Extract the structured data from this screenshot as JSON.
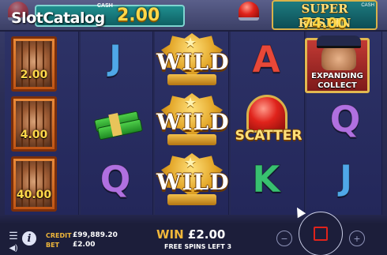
{
  "watermark": {
    "brand": "SlotCatalog",
    "cash_tag": "CASH"
  },
  "header": {
    "bet_value": "2.00",
    "super_respin": {
      "title": "SUPER RESPIN",
      "value": "74.00",
      "cash_tag": "CASH"
    }
  },
  "reels": {
    "jail_values": [
      "2.00",
      "4.00",
      "40.00"
    ],
    "letters": {
      "J": "J",
      "Q": "Q",
      "A": "A",
      "K": "K"
    },
    "wild_label": "WILD",
    "scatter_label": "SCATTER",
    "collect": {
      "line1": "EXPANDING",
      "line2": "COLLECT"
    }
  },
  "footer": {
    "credit_label": "CREDIT",
    "credit_value": "£99,889.20",
    "bet_label": "BET",
    "bet_value": "£2.00",
    "win_label": "WIN",
    "win_value": "£2.00",
    "free_spins_text": "FREE SPINS LEFT 3",
    "minus": "−",
    "plus": "+"
  },
  "icons": [
    "menu-icon",
    "sound-icon",
    "info-icon",
    "siren-icon",
    "stop-icon",
    "cursor-icon"
  ],
  "colors": {
    "gold": "#ffd84a",
    "label_orange": "#f0b73a",
    "siren_red": "#e0231b",
    "panel_teal": "#0f5f63"
  }
}
